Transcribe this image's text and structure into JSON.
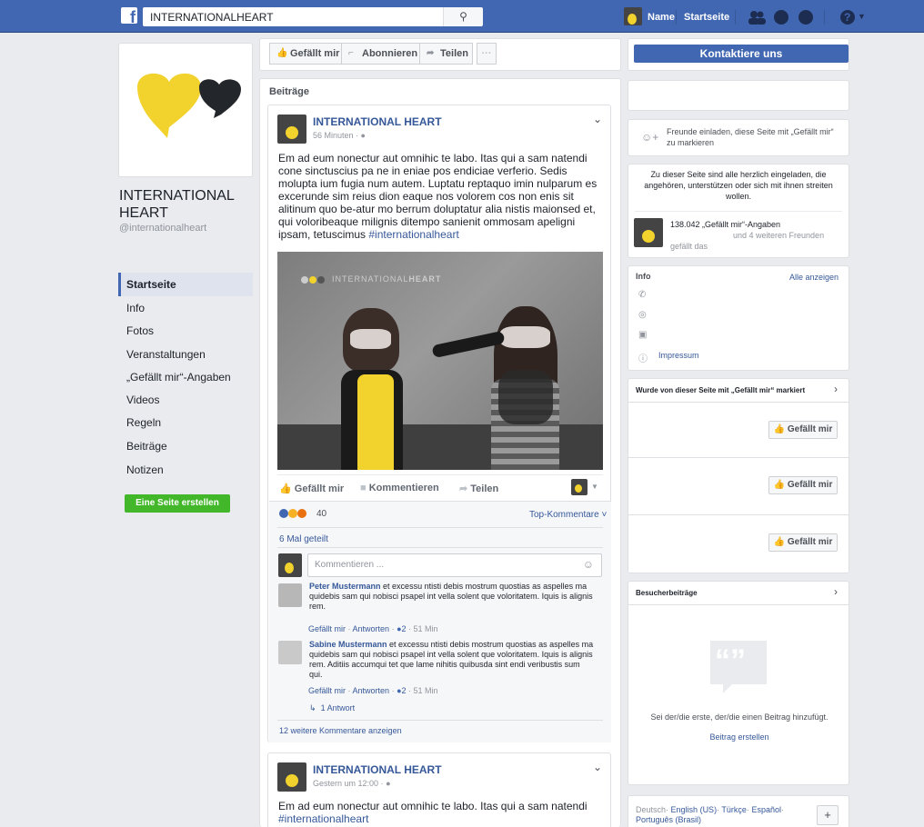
{
  "topbar": {
    "logo": "f",
    "search_value": "INTERNATIONALHEART",
    "search_icon": "search-icon",
    "user_name": "Name",
    "home_label": "Startseite"
  },
  "page": {
    "name_line1": "INTERNATIONAL",
    "name_line2": "HEART",
    "handle": "@internationalheart",
    "logo_colors": {
      "heart": "#f2d22c",
      "bubble": "#23272b"
    }
  },
  "sidebar": {
    "items": [
      {
        "label": "Startseite",
        "active": true
      },
      {
        "label": "Info"
      },
      {
        "label": "Fotos"
      },
      {
        "label": "Veranstaltungen"
      },
      {
        "label": "„Gefällt mir“-Angaben"
      },
      {
        "label": "Videos"
      },
      {
        "label": "Regeln"
      },
      {
        "label": "Beiträge"
      },
      {
        "label": "Notizen"
      }
    ],
    "create_page": "Eine Seite erstellen"
  },
  "actions": {
    "like": "Gefällt mir",
    "follow": "Abonnieren",
    "share": "Teilen",
    "more": "···",
    "contact": "Kontaktiere uns"
  },
  "posts_header": "Beiträge",
  "post1": {
    "author": "INTERNATIONAL HEART",
    "time": "56 Minuten ·",
    "text": "Em ad eum nonectur aut omnihic te labo. Itas qui a sam natendi cone sinctuscius pa ne in eniae pos endiciae verferio. Sedis molupta ium fugia num autem. Luptatu reptaquo imin nulparum es excerunde sim reius dion eaque nos volorem cos non enis sit alitinum quo be-atur mo berrum doluptatur alia nistis maionsed et, qui voloribeaque milignis ditempo sanienit ommosam apeligni ipsam, tetuscimus",
    "hashtag": "#internationalheart",
    "image_brand_a": "INTERNATIONAL",
    "image_brand_b": "HEART",
    "like": "Gefällt mir",
    "comment": "Kommentieren",
    "share": "Teilen",
    "reactions_count": "40",
    "top_comments": "Top-Kommentare ˅",
    "shares": "6 Mal geteilt",
    "comment_placeholder": "Kommentieren ...",
    "comments": [
      {
        "name": "Peter Mustermann",
        "text": "et excessu ntisti debis mostrum quostias as aspelles ma quidebis sam qui nobisci psapel int vella solent que voloritatem. Iquis is alignis rem.",
        "meta_like": "Gefällt mir",
        "meta_reply": "Antworten",
        "meta_count": "2",
        "meta_time": "· 51 Min"
      },
      {
        "name": "Sabine Mustermann",
        "text": "et excessu ntisti debis mostrum quostias as aspelles ma quidebis sam qui nobisci psapel int vella solent que voloritatem. Iquis is alignis rem. Aditiis accumqui tet que lame nihitis quibusda sint endi veribustis sum qui.",
        "meta_like": "Gefällt mir",
        "meta_reply": "Antworten",
        "meta_count": "2",
        "meta_time": "· 51 Min"
      }
    ],
    "reply_link": "1 Antwort",
    "more_comments": "12 weitere Kommentare anzeigen"
  },
  "post2": {
    "author": "INTERNATIONAL HEART",
    "time": "Gestern um 12:00 ·",
    "text": "Em ad eum nonectur aut omnihic te labo. Itas qui a sam natendi",
    "hashtag": "#internationalheart"
  },
  "right": {
    "invite": "Freunde einladen, diese Seite mit „Gefällt mir“ zu markieren",
    "welcome": "Zu dieser Seite sind alle herzlich eingeladen, die angehören, unterstützen oder sich mit ihnen streiten wollen.",
    "likes_count": "138.042 „Gefällt mir“-Angaben",
    "likes_friends": "und 4 weiteren Freunden",
    "likes_friends2": "gefällt das",
    "info_title": "Info",
    "info_all": "Alle anzeigen",
    "impressum": "Impressum",
    "liked_by_title": "Wurde von dieser Seite mit „Gefällt mir“ markiert",
    "like_btn": "Gefällt mir",
    "visitor_title": "Besucherbeiträge",
    "visitor_empty": "Sei der/die erste, der/die einen Beitrag hinzufügt.",
    "visitor_create": "Beitrag erstellen",
    "lang_current": "Deutsch",
    "lang_sep": "·",
    "lang1": "English (US)",
    "lang2": "Türkçe",
    "lang3": "Español",
    "lang4": "Português (Brasil)",
    "lang_add": "+"
  }
}
